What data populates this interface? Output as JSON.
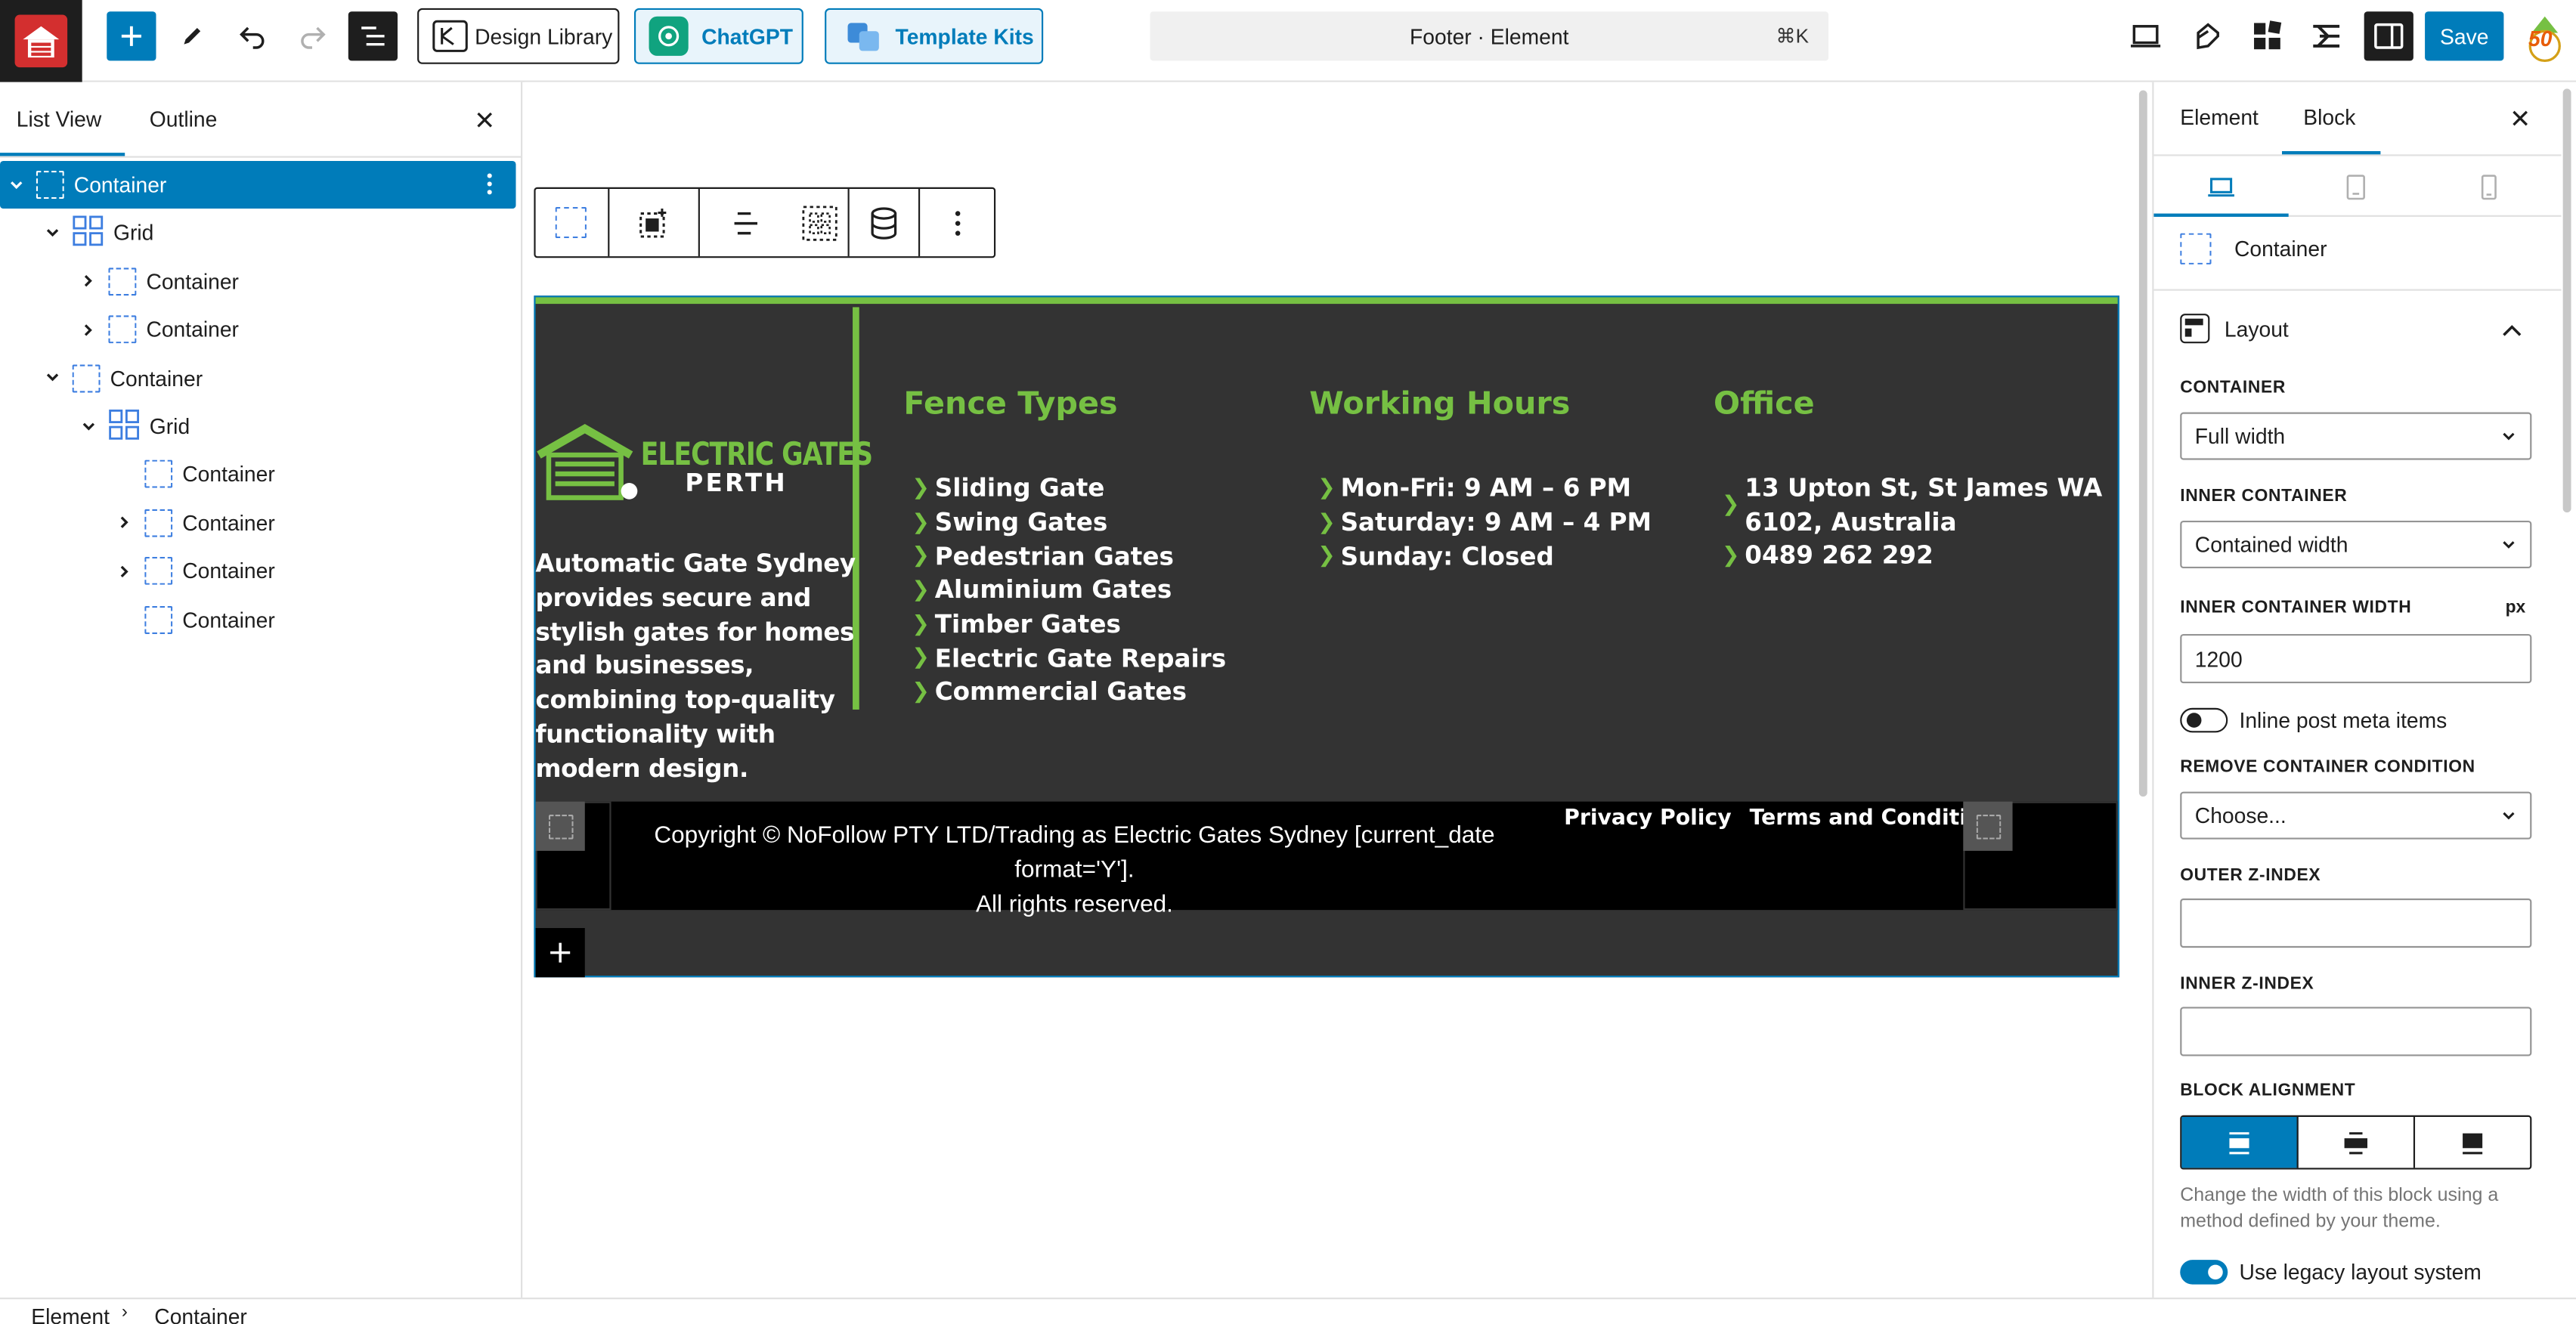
{
  "topbar": {
    "design_library": "Design Library",
    "chatgpt": "ChatGPT",
    "template_kits": "Template Kits",
    "command_title": "Footer · Element",
    "command_shortcut": "⌘K",
    "save": "Save",
    "badge_number": "50"
  },
  "left_panel": {
    "tabs": [
      "List View",
      "Outline"
    ],
    "active_tab": "List View",
    "tree": [
      {
        "label": "Container",
        "depth": 0,
        "expanded": true,
        "selected": true
      },
      {
        "label": "Grid",
        "depth": 1,
        "expanded": true
      },
      {
        "label": "Container",
        "depth": 2,
        "expandable": true
      },
      {
        "label": "Container",
        "depth": 2,
        "expandable": true
      },
      {
        "label": "Container",
        "depth": 1,
        "expanded": true
      },
      {
        "label": "Grid",
        "depth": 2,
        "expanded": true
      },
      {
        "label": "Container",
        "depth": 3
      },
      {
        "label": "Container",
        "depth": 3,
        "expandable": true
      },
      {
        "label": "Container",
        "depth": 3,
        "expandable": true
      },
      {
        "label": "Container",
        "depth": 3
      }
    ]
  },
  "footer": {
    "logo_line1": "ELECTRIC GATES",
    "logo_line2": "PERTH",
    "description": "Automatic Gate Sydney provides secure and stylish gates for homes and businesses, combining top-quality functionality with modern design.",
    "columns": [
      {
        "title": "Fence Types",
        "items": [
          "Sliding Gate",
          "Swing Gates",
          "Pedestrian Gates",
          "Aluminium Gates",
          "Timber Gates",
          "Electric Gate Repairs",
          "Commercial Gates"
        ]
      },
      {
        "title": "Working Hours",
        "items": [
          "Mon-Fri: 9 AM – 6 PM",
          "Saturday: 9 AM – 4 PM",
          "Sunday: Closed"
        ]
      },
      {
        "title": "Office",
        "items": [
          "13 Upton St, St James WA 6102, Australia",
          "0489 262 292"
        ]
      }
    ],
    "copyright_line1": "Copyright © NoFollow PTY LTD/Trading as Electric Gates Sydney [current_date format='Y'].",
    "copyright_line2": "All rights reserved.",
    "links": [
      "Privacy Policy",
      "Terms and Conditions"
    ]
  },
  "right_panel": {
    "tabs": [
      "Element",
      "Block"
    ],
    "active_tab": "Block",
    "block_name": "Container",
    "section_title": "Layout",
    "container_label": "CONTAINER",
    "container_value": "Full width",
    "inner_container_label": "INNER CONTAINER",
    "inner_container_value": "Contained width",
    "inner_width_label": "INNER CONTAINER WIDTH",
    "inner_width_unit": "px",
    "inner_width_value": "1200",
    "inline_meta_label": "Inline post meta items",
    "inline_meta_on": false,
    "remove_condition_label": "REMOVE CONTAINER CONDITION",
    "remove_condition_value": "Choose...",
    "outer_z_label": "OUTER Z-INDEX",
    "outer_z_value": "",
    "inner_z_label": "INNER Z-INDEX",
    "inner_z_value": "",
    "alignment_label": "BLOCK ALIGNMENT",
    "alignment_help": "Change the width of this block using a method defined by your theme.",
    "legacy_label": "Use legacy layout system",
    "legacy_on": true
  },
  "breadcrumb": [
    "Element",
    "Container"
  ],
  "colors": {
    "accent": "#007cba",
    "footer_green": "#76c043",
    "footer_bg": "#333333"
  }
}
